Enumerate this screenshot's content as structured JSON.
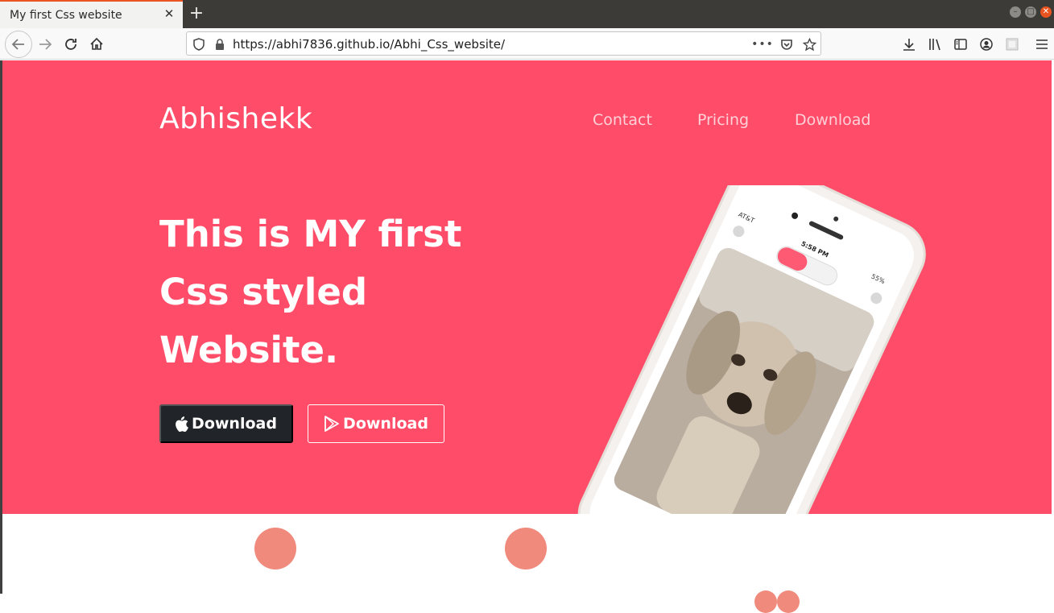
{
  "browser": {
    "tab_title": "My first Css website",
    "tab_close": "✕",
    "new_tab": "+",
    "url": "https://abhi7836.github.io/Abhi_Css_website/",
    "page_actions": "•••"
  },
  "site": {
    "brand": "Abhishekk",
    "nav": [
      "Contact",
      "Pricing",
      "Download"
    ],
    "headline": [
      "This is MY first",
      "Css styled",
      "Website."
    ],
    "buttons": {
      "apple_download": "Download",
      "play_download": "Download"
    },
    "phone": {
      "carrier": "AT&T",
      "time": "5:58 PM",
      "battery": "55%"
    }
  },
  "colors": {
    "hero_bg": "#ff4c68",
    "dark_button": "#212529",
    "feature_icon": "#ef8a7c"
  },
  "icons": [
    "back-icon",
    "forward-icon",
    "reload-icon",
    "home-icon",
    "shield-icon",
    "lock-icon",
    "pocket-icon",
    "star-icon",
    "download-icon",
    "library-icon",
    "sidebar-icon",
    "account-icon",
    "extension-icon",
    "menu-icon",
    "apple-icon",
    "play-store-icon"
  ]
}
